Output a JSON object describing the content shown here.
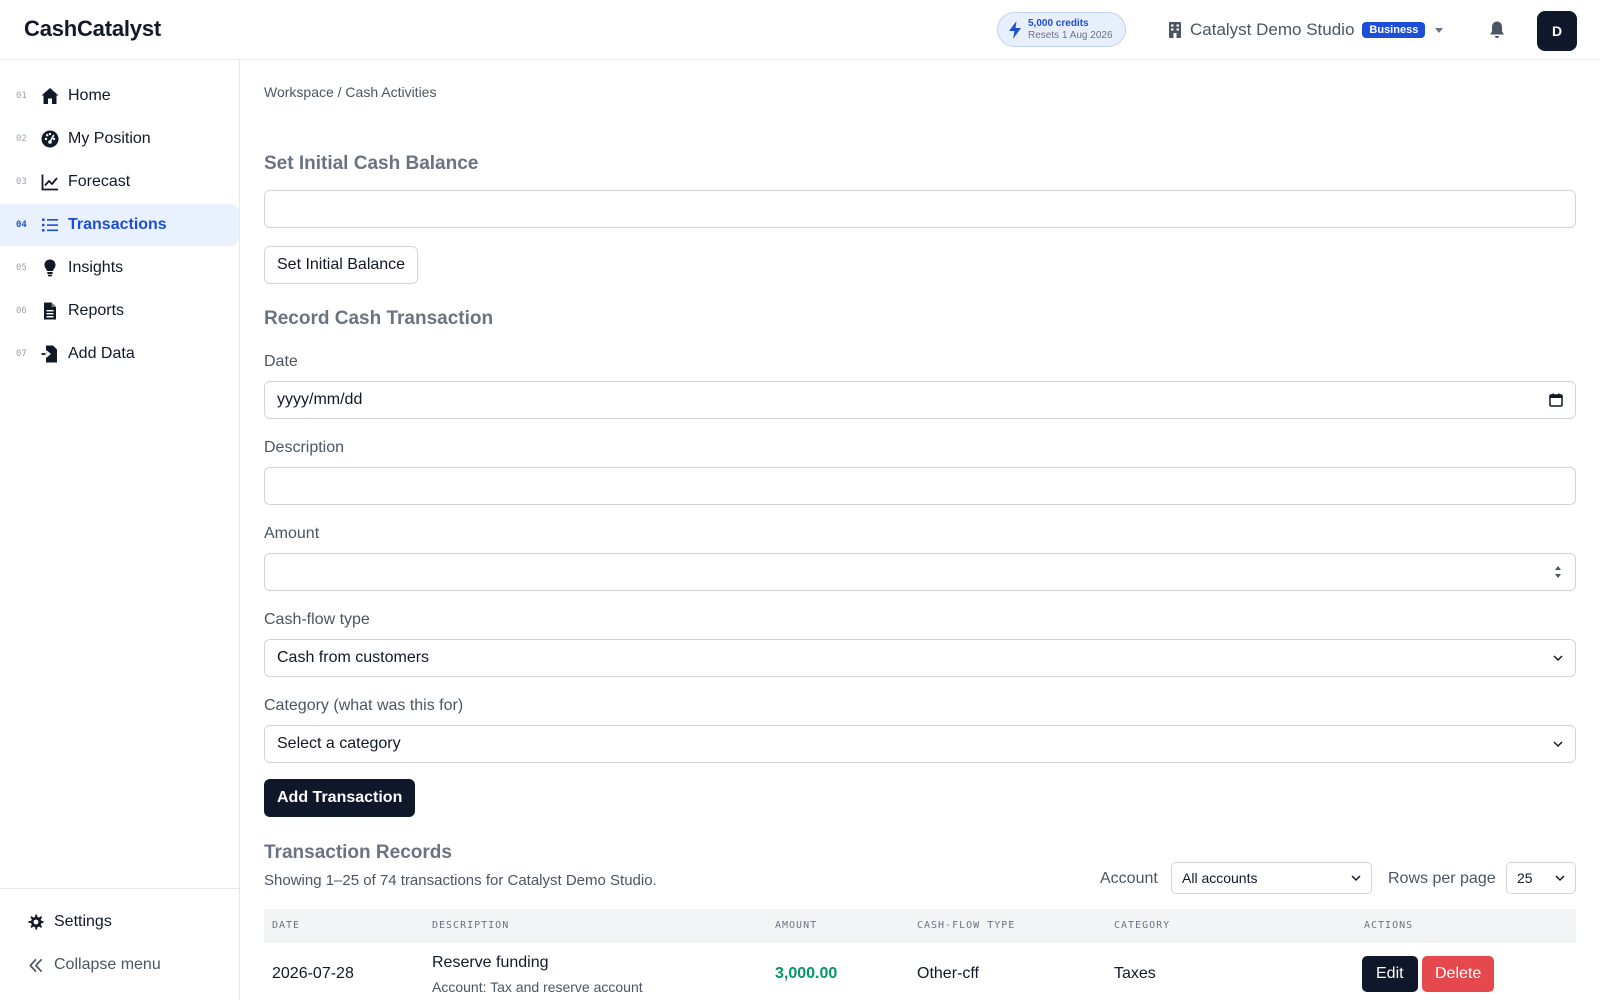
{
  "header": {
    "brand": "CashCatalyst",
    "credits_amount": "5,000 credits",
    "credits_reset": "Resets 1 Aug 2026",
    "org_name": "Catalyst Demo Studio",
    "plan_badge": "Business",
    "avatar_initial": "D"
  },
  "sidebar": {
    "items": [
      {
        "num": "01",
        "label": "Home",
        "icon": "home-icon"
      },
      {
        "num": "02",
        "label": "My Position",
        "icon": "gauge-icon"
      },
      {
        "num": "03",
        "label": "Forecast",
        "icon": "line-chart-icon"
      },
      {
        "num": "04",
        "label": "Transactions",
        "icon": "list-icon",
        "active": true
      },
      {
        "num": "05",
        "label": "Insights",
        "icon": "lightbulb-icon"
      },
      {
        "num": "06",
        "label": "Reports",
        "icon": "file-icon"
      },
      {
        "num": "07",
        "label": "Add Data",
        "icon": "file-import-icon"
      }
    ],
    "settings_label": "Settings",
    "collapse_label": "Collapse menu"
  },
  "breadcrumb": "Workspace / Cash Activities",
  "initial_balance": {
    "title": "Set Initial Cash Balance",
    "value": "",
    "button_label": "Set Initial Balance"
  },
  "record_form": {
    "title": "Record Cash Transaction",
    "date_label": "Date",
    "date_placeholder": "yyyy/mm/dd",
    "description_label": "Description",
    "description_value": "",
    "amount_label": "Amount",
    "amount_value": "",
    "cashflow_label": "Cash-flow type",
    "cashflow_value": "Cash from customers",
    "category_label": "Category (what was this for)",
    "category_value": "Select a category",
    "submit_label": "Add Transaction"
  },
  "records": {
    "title": "Transaction Records",
    "summary": "Showing 1–25 of 74 transactions for Catalyst Demo Studio.",
    "account_filter_label": "Account",
    "account_filter_value": "All accounts",
    "rows_per_page_label": "Rows per page",
    "rows_per_page_value": "25",
    "columns": [
      "DATE",
      "DESCRIPTION",
      "AMOUNT",
      "CASH-FLOW TYPE",
      "CATEGORY",
      "ACTIONS"
    ],
    "rows": [
      {
        "date": "2026-07-28",
        "description": "Reserve funding",
        "account": "Account: Tax and reserve account",
        "amount": "3,000.00",
        "cashflow_type": "Other-cff",
        "category": "Taxes",
        "edit_label": "Edit",
        "delete_label": "Delete"
      }
    ]
  },
  "colors": {
    "accent": "#1d4ed8",
    "dark": "#0f172a",
    "positive": "#059669",
    "danger": "#e5484d",
    "active_bg": "#eaf1fe"
  }
}
